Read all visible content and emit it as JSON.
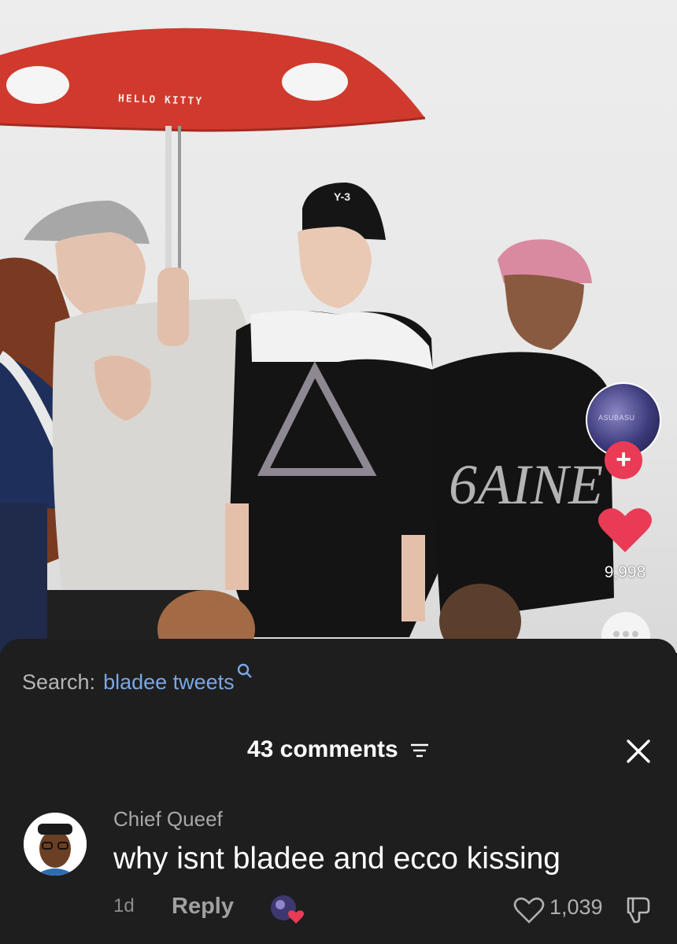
{
  "video": {
    "umbrella_text": "HELLO KITTY",
    "cap_text": "Y-3",
    "shirt_text": "6AINE",
    "creator_avatar_text": "ASUBASU",
    "follow_symbol": "+",
    "like_count": "9,998",
    "accent_color": "#ea3b56"
  },
  "search": {
    "label": "Search:",
    "query": "bladee tweets",
    "query_color": "#7aa7e6"
  },
  "comments": {
    "header": "43 comments",
    "items": [
      {
        "author": "Chief Queef",
        "text": "why isnt bladee and ecco kissing",
        "age": "1d",
        "reply_label": "Reply",
        "likes": "1,039"
      }
    ]
  },
  "icons": {
    "search": "search-icon",
    "sort": "sort-icon",
    "close": "close-icon",
    "heart": "heart-icon",
    "dislike": "dislike-icon",
    "more": "more-icon"
  }
}
